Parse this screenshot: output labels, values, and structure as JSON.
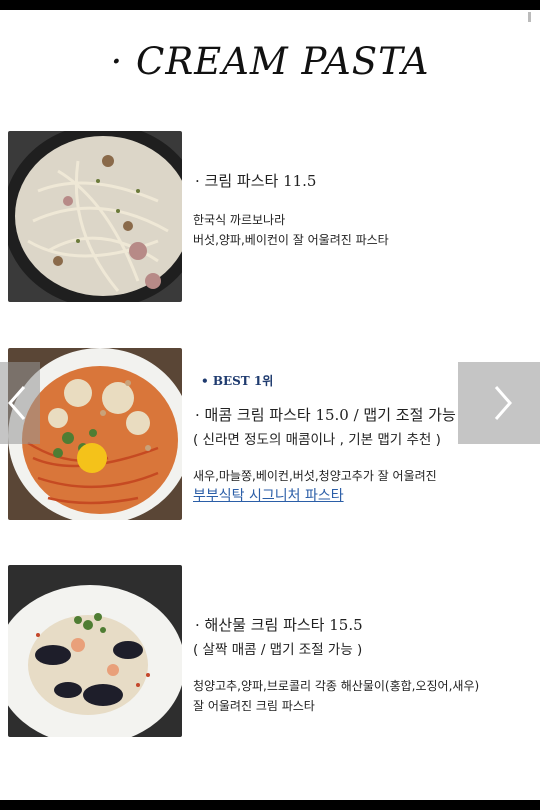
{
  "title": "· CREAM PASTA",
  "items": [
    {
      "name": "· 크림 파스타 11.5",
      "desc1": "한국식 까르보나라",
      "desc2": "버섯,양파,베이컨이 잘 어울려진 파스타"
    },
    {
      "badge": "• BEST 1위",
      "name": "· 매콤 크림 파스타 15.0 / 맵기 조절 가능",
      "note": "( 신라면 정도의 매콤이나 , 기본 맵기 추천 )",
      "desc1": "새우,마늘쫑,베이컨,버섯,청양고추가 잘 어울려진",
      "link": "부부식탁 시그니처 파스타"
    },
    {
      "name": "· 해산물 크림 파스타 15.5",
      "note": "( 살짝 매콤 / 맵기 조절 가능 )",
      "desc1": "청양고추,양파,브로콜리 각종 해산물이(홍합,오징어,새우)",
      "desc2": "잘 어울려진 크림 파스타"
    }
  ],
  "icons": {
    "prev": "chevron-left-icon",
    "next": "chevron-right-icon"
  },
  "colors": {
    "best": "#1f3b6f",
    "link": "#2b5ea7",
    "nav_overlay": "#969696"
  }
}
